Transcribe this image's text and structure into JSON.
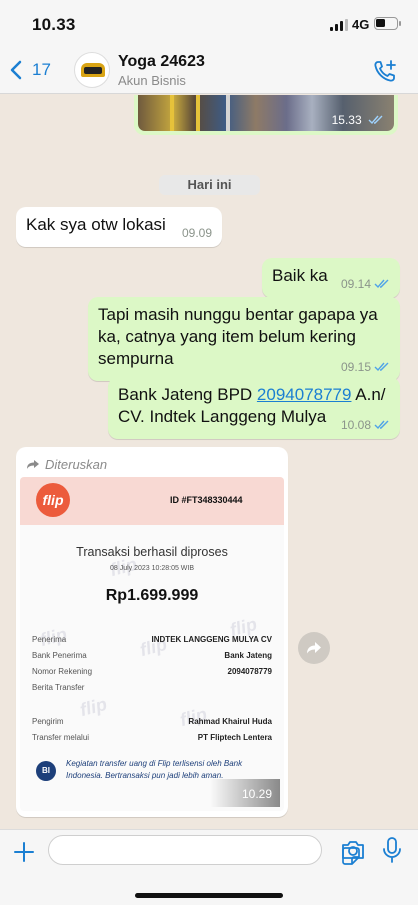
{
  "status_bar": {
    "time": "10.33",
    "network": "4G"
  },
  "header": {
    "back_count": "17",
    "contact_name": "Yoga 24623",
    "contact_subtitle": "Akun Bisnis"
  },
  "photo_message": {
    "time": "15.33"
  },
  "day_separator": "Hari ini",
  "messages": [
    {
      "direction": "incoming",
      "text": "Kak sya otw lokasi",
      "time": "09.09"
    },
    {
      "direction": "outgoing",
      "text": "Baik ka",
      "time": "09.14"
    },
    {
      "direction": "outgoing",
      "text": "Tapi masih nunggu bentar gapapa ya ka, catnya yang item belum kering sempurna",
      "time": "09.15"
    },
    {
      "direction": "outgoing",
      "text_prefix": "Bank Jateng BPD ",
      "link": "2094078779",
      "text_suffix": " A.n/ CV. Indtek Langgeng Mulya",
      "time": "10.08"
    }
  ],
  "forwarded": {
    "label": "Diteruskan",
    "time": "10.29",
    "receipt": {
      "brand": "flip",
      "id": "ID #FT348330444",
      "title": "Transaksi berhasil diproses",
      "date": "08 July 2023 10:28:05 WIB",
      "amount": "Rp1.699.999",
      "rows": [
        {
          "label": "Penerima",
          "value": "INDTEK LANGGENG MULYA CV"
        },
        {
          "label": "Bank Penerima",
          "value": "Bank Jateng"
        },
        {
          "label": "Nomor Rekening",
          "value": "2094078779"
        },
        {
          "label": "Berita Transfer",
          "value": ""
        },
        {
          "label": "Pengirim",
          "value": "Rahmad Khairul Huda"
        },
        {
          "label": "Transfer melalui",
          "value": "PT Fliptech Lentera"
        }
      ],
      "note": "Kegiatan transfer uang di Flip terlisensi oleh Bank Indonesia. Bertransaksi pun jadi lebih aman."
    }
  },
  "colors": {
    "accent": "#1b7fd2",
    "outgoing_bubble": "#dcf8c6",
    "incoming_bubble": "#ffffff",
    "chat_background": "#efe7de",
    "flip_brand": "#ec5b3c"
  },
  "icons": [
    "back-chevron-icon",
    "add-call-icon",
    "read-ticks-icon",
    "forward-arrow-icon",
    "share-icon",
    "plus-icon",
    "sticker-icon",
    "camera-icon",
    "mic-icon"
  ]
}
